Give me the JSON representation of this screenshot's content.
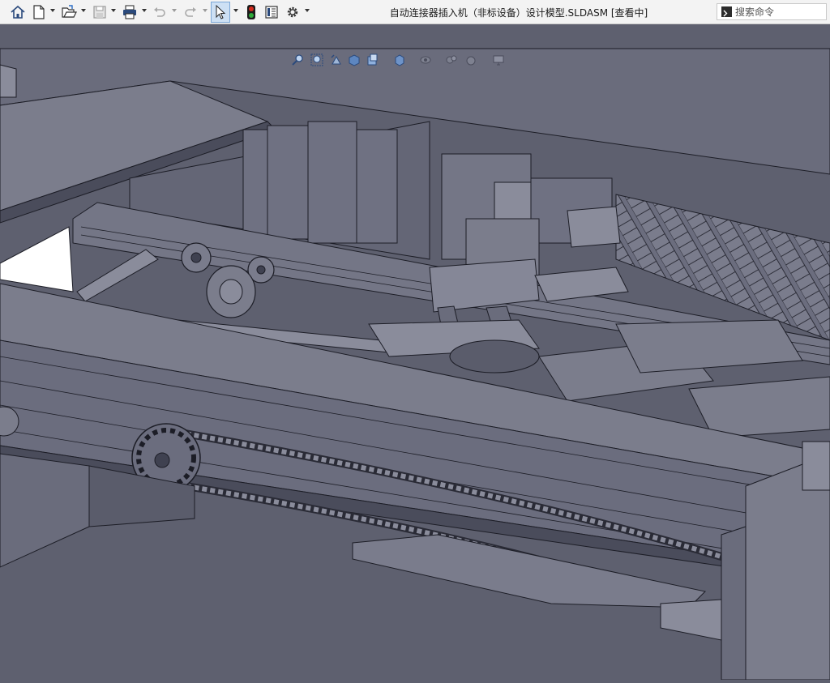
{
  "window": {
    "title": "自动连接器插入机（非标设备）设计模型.SLDASM [查看中]"
  },
  "search": {
    "placeholder": "搜索命令",
    "value": ""
  },
  "toolbar": {
    "buttons": [
      {
        "name": "home",
        "icon": "home-icon"
      },
      {
        "name": "new-document",
        "icon": "new-document-icon"
      },
      {
        "name": "open",
        "icon": "open-folder-icon"
      },
      {
        "name": "save",
        "icon": "save-icon"
      },
      {
        "name": "print",
        "icon": "print-icon"
      },
      {
        "name": "undo",
        "icon": "undo-icon"
      },
      {
        "name": "redo",
        "icon": "redo-icon"
      },
      {
        "name": "select",
        "icon": "select-arrow-icon"
      },
      {
        "name": "rebuild",
        "icon": "traffic-light-icon"
      },
      {
        "name": "file-properties",
        "icon": "file-properties-icon"
      },
      {
        "name": "options",
        "icon": "gear-icon"
      }
    ]
  },
  "heads_up_toolbar": {
    "items": [
      "zoom-to-fit-icon",
      "zoom-to-area-icon",
      "previous-view-icon",
      "section-view-icon",
      "view-orientation-icon",
      "display-style-icon",
      "hide-show-icon",
      "edit-appearance-icon",
      "apply-scene-icon",
      "view-settings-icon"
    ]
  },
  "colors": {
    "background": "#5e606f",
    "part_face": "#6b6d7e",
    "part_light": "#8a8c9b",
    "part_dark": "#3f4150",
    "edge": "#1c1d26",
    "titlebar": "#f3f3f3",
    "traffic_red": "#d52b1e",
    "traffic_green": "#2eaa3a"
  }
}
